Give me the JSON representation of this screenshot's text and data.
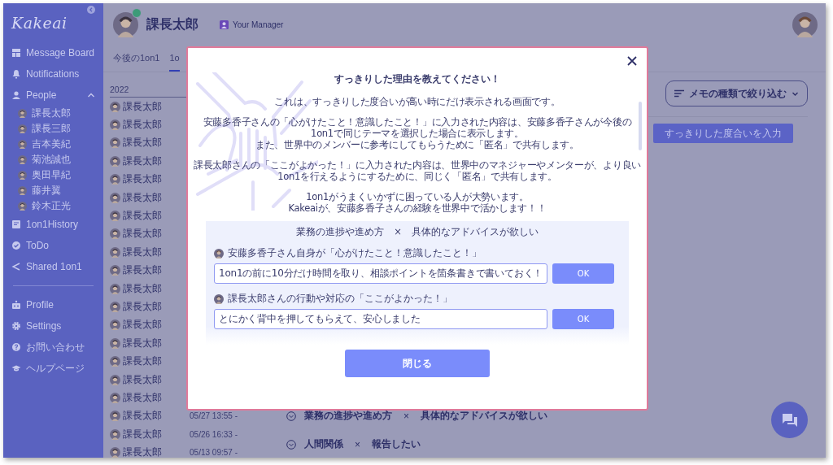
{
  "sidebar": {
    "logo": "Kakeai",
    "groups": [
      [
        {
          "label": "Message Board"
        },
        {
          "label": "Notifications"
        },
        {
          "label": "People",
          "expanded": true,
          "children": [
            {
              "label": "課長太郎"
            },
            {
              "label": "課長三郎"
            },
            {
              "label": "吉本美紀"
            },
            {
              "label": "菊池誠也"
            },
            {
              "label": "奥田早紀"
            },
            {
              "label": "藤井翼"
            },
            {
              "label": "鈴木正光"
            }
          ]
        },
        {
          "label": "1on1History"
        },
        {
          "label": "ToDo"
        },
        {
          "label": "Shared 1on1"
        }
      ],
      [
        {
          "label": "Profile"
        },
        {
          "label": "Settings"
        },
        {
          "label": "お問い合わせ"
        },
        {
          "label": "ヘルプページ"
        }
      ]
    ]
  },
  "header": {
    "name": "課長太郎",
    "online": true,
    "role": "Your Manager"
  },
  "tabs": [
    {
      "label": "今後の1on1",
      "selected": false
    },
    {
      "label": "1o",
      "selected": true
    }
  ],
  "history": {
    "year": "2022",
    "rows": [
      {
        "name": "課長太郎"
      },
      {
        "name": "課長太郎"
      },
      {
        "name": "課長太郎"
      },
      {
        "name": "課長太郎"
      },
      {
        "name": "課長太郎"
      },
      {
        "name": "課長太郎"
      },
      {
        "name": "課長太郎"
      },
      {
        "name": "課長太郎"
      },
      {
        "name": "課長太郎"
      },
      {
        "name": "課長太郎"
      },
      {
        "name": "課長太郎"
      },
      {
        "name": "課長太郎"
      },
      {
        "name": "課長太郎"
      },
      {
        "name": "課長太郎"
      },
      {
        "name": "課長太郎"
      },
      {
        "name": "課長太郎"
      },
      {
        "name": "課長太郎"
      },
      {
        "name": "課長太郎",
        "date": "05/27 13:55 -"
      },
      {
        "name": "課長太郎",
        "date": "05/26 16:33 -"
      },
      {
        "name": "課長太郎",
        "date": "05/13 09:57 -"
      }
    ]
  },
  "detail": {
    "filter_button": "メモの種類で絞り込む",
    "rate_button": "すっきりした度合いを入力",
    "topics": [
      {
        "theme": "業務の進捗や進め方",
        "separator": "×",
        "request": "具体的なアドバイスが欲しい"
      },
      {
        "theme": "人間関係",
        "separator": "×",
        "request": "報告したい"
      }
    ]
  },
  "modal": {
    "title": "すっきりした理由を教えてください！",
    "paragraphs": [
      [
        "これは、すっきりした度合いが高い時にだけ表示される画面です。"
      ],
      [
        "安藤多香子さんの「心がけたこと！意識したこと！」に入力された内容は、安藤多香子さんが今後の",
        "1on1で同じテーマを選択した場合に表示します。",
        "また、世界中のメンバーに参考にしてもらうために「匿名」で共有します。"
      ],
      [
        "課長太郎さんの「ここがよかった！」に入力された内容は、世界中のマネジャーやメンターが、より良い",
        "1on1を行えるようにするために、同じく「匿名」で共有します。"
      ],
      [
        "1on1がうまくいかずに困っている人が大勢います。",
        "Kakeaiが、安藤多香子さんの経験を世界中で活かします！！"
      ]
    ],
    "panel": {
      "heading": "業務の進捗や進め方　×　具体的なアドバイスが欲しい",
      "questions": [
        {
          "label": "安藤多香子さん自身が「心がけたこと！意識したこと！」",
          "value": "1on1の前に10分だけ時間を取り、相談ポイントを箇条書きで書いておく！",
          "button": "OK"
        },
        {
          "label": "課長太郎さんの行動や対応の「ここがよかった！」",
          "value": "とにかく背中を押してもらえて、安心しました",
          "button": "OK"
        }
      ]
    },
    "close_button": "閉じる"
  }
}
